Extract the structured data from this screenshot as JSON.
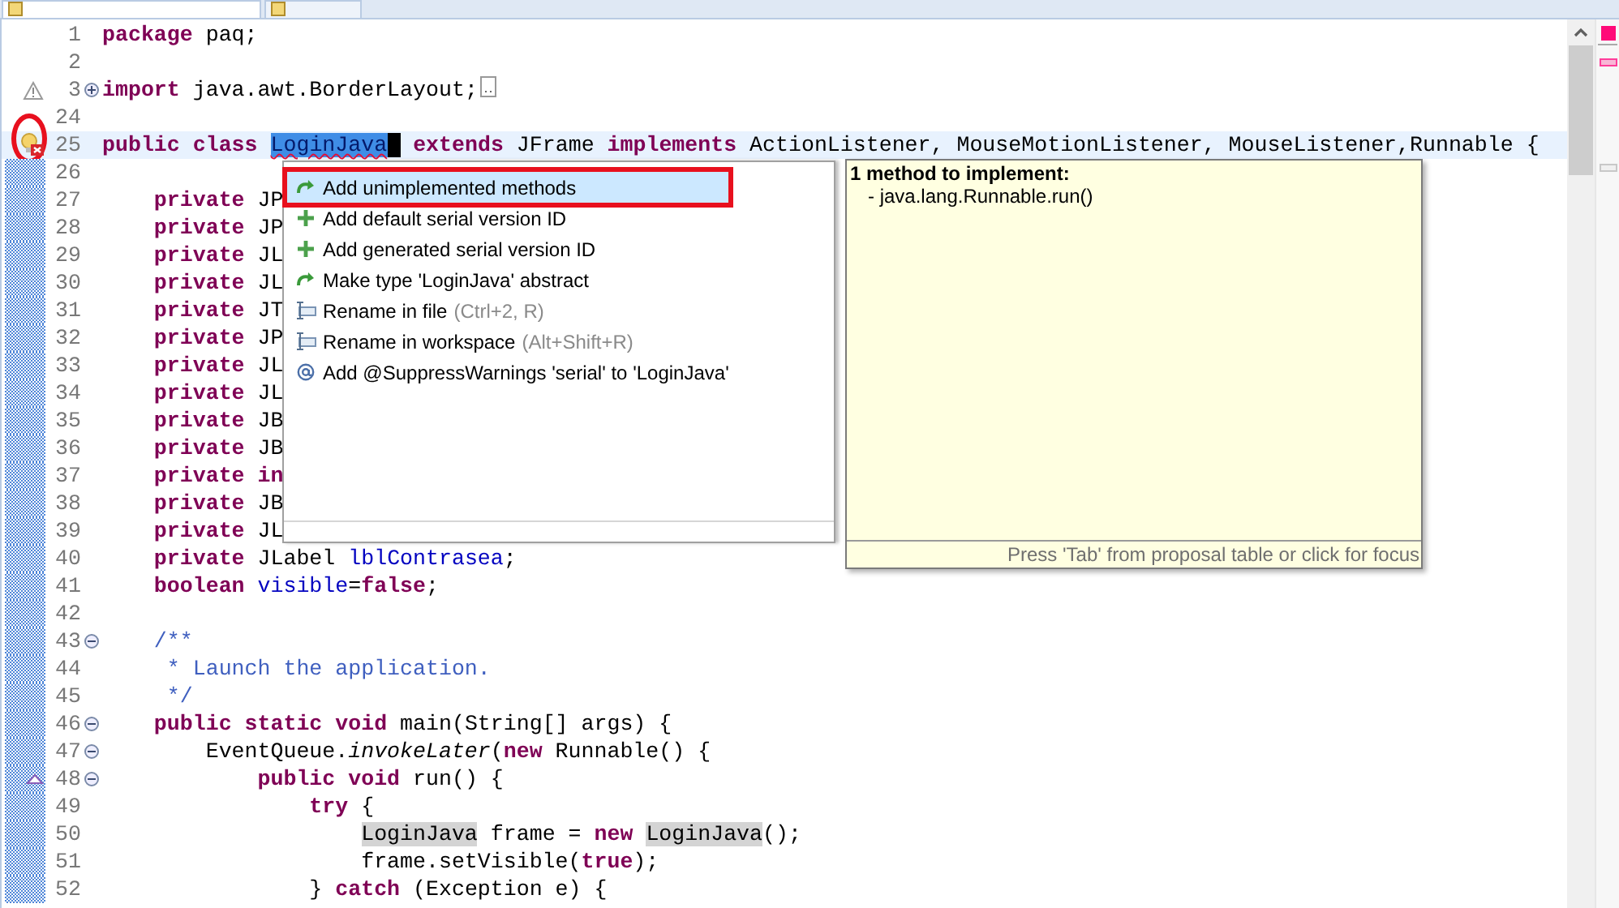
{
  "editor": {
    "lines": [
      {
        "number": "1",
        "changed": false,
        "current": false,
        "circled": false,
        "tokens": [
          {
            "text": "package",
            "kind": "keyword"
          },
          {
            "text": " paq;",
            "kind": "plain"
          }
        ]
      },
      {
        "number": "2",
        "changed": false,
        "current": false,
        "circled": false
      },
      {
        "number": "3",
        "fold": {
          "expanded": false
        },
        "marker": {
          "kind": "warning"
        },
        "changed": false,
        "current": false,
        "circled": false,
        "tokens": [
          {
            "text": "import",
            "kind": "keyword"
          },
          {
            "text": " java.awt.BorderLayout;",
            "kind": "plain"
          }
        ]
      },
      {
        "number": "24",
        "changed": false,
        "current": false,
        "circled": false
      },
      {
        "number": "25",
        "marker": {
          "kind": "quick-fix-error"
        },
        "changed": false,
        "current": true,
        "circled": true,
        "tokens": [
          {
            "text": "public",
            "kind": "keyword"
          },
          {
            "text": " class",
            "kind": "keyword"
          },
          {
            "text": " LoginJava",
            "kind": "selected"
          },
          {
            "text": " extends",
            "kind": "keyword"
          },
          {
            "text": " JFrame",
            "kind": "plain"
          },
          {
            "text": " implements",
            "kind": "keyword"
          },
          {
            "text": " ActionListener, MouseMotionListener, MouseListener,Runnable {",
            "kind": "plain"
          }
        ]
      },
      {
        "number": "26",
        "changed": true,
        "current": false,
        "circled": false
      },
      {
        "number": "27",
        "changed": true,
        "current": false,
        "circled": false,
        "tokens": [
          {
            "text": "    private",
            "kind": "keyword"
          },
          {
            "text": " JP",
            "kind": "plain"
          }
        ]
      },
      {
        "number": "28",
        "changed": true,
        "current": false,
        "circled": false,
        "tokens": [
          {
            "text": "    private",
            "kind": "keyword"
          },
          {
            "text": " JP",
            "kind": "plain"
          }
        ]
      },
      {
        "number": "29",
        "changed": true,
        "current": false,
        "circled": false,
        "tokens": [
          {
            "text": "    private",
            "kind": "keyword"
          },
          {
            "text": " JL",
            "kind": "plain"
          }
        ]
      },
      {
        "number": "30",
        "changed": true,
        "current": false,
        "circled": false,
        "tokens": [
          {
            "text": "    private",
            "kind": "keyword"
          },
          {
            "text": " JL",
            "kind": "plain"
          }
        ]
      },
      {
        "number": "31",
        "changed": true,
        "current": false,
        "circled": false,
        "tokens": [
          {
            "text": "    private",
            "kind": "keyword"
          },
          {
            "text": " JT",
            "kind": "plain"
          }
        ]
      },
      {
        "number": "32",
        "changed": true,
        "current": false,
        "circled": false,
        "tokens": [
          {
            "text": "    private",
            "kind": "keyword"
          },
          {
            "text": " JP",
            "kind": "plain"
          }
        ]
      },
      {
        "number": "33",
        "changed": true,
        "current": false,
        "circled": false,
        "tokens": [
          {
            "text": "    private",
            "kind": "keyword"
          },
          {
            "text": " JL",
            "kind": "plain"
          }
        ]
      },
      {
        "number": "34",
        "changed": true,
        "current": false,
        "circled": false,
        "tokens": [
          {
            "text": "    private",
            "kind": "keyword"
          },
          {
            "text": " JL",
            "kind": "plain"
          }
        ]
      },
      {
        "number": "35",
        "changed": true,
        "current": false,
        "circled": false,
        "tokens": [
          {
            "text": "    private",
            "kind": "keyword"
          },
          {
            "text": " JB",
            "kind": "plain"
          }
        ]
      },
      {
        "number": "36",
        "changed": true,
        "current": false,
        "circled": false,
        "tokens": [
          {
            "text": "    private",
            "kind": "keyword"
          },
          {
            "text": " JB",
            "kind": "plain"
          }
        ]
      },
      {
        "number": "37",
        "changed": true,
        "current": false,
        "circled": false,
        "tokens": [
          {
            "text": "    private",
            "kind": "keyword"
          },
          {
            "text": " in",
            "kind": "keyword"
          }
        ]
      },
      {
        "number": "38",
        "changed": true,
        "current": false,
        "circled": false,
        "tokens": [
          {
            "text": "    private",
            "kind": "keyword"
          },
          {
            "text": " JB",
            "kind": "plain"
          }
        ]
      },
      {
        "number": "39",
        "changed": true,
        "current": false,
        "circled": false,
        "tokens": [
          {
            "text": "    private",
            "kind": "keyword"
          },
          {
            "text": " JL",
            "kind": "plain"
          }
        ]
      },
      {
        "number": "40",
        "changed": true,
        "current": false,
        "circled": false,
        "tokens": [
          {
            "text": "    private",
            "kind": "keyword"
          },
          {
            "text": " JLabel ",
            "kind": "plain"
          },
          {
            "text": "lblContrasea",
            "kind": "field"
          },
          {
            "text": ";",
            "kind": "plain"
          }
        ]
      },
      {
        "number": "41",
        "changed": true,
        "current": false,
        "circled": false,
        "tokens": [
          {
            "text": "    boolean",
            "kind": "keyword"
          },
          {
            "text": " visible",
            "kind": "field"
          },
          {
            "text": "=",
            "kind": "plain"
          },
          {
            "text": "false",
            "kind": "keyword"
          },
          {
            "text": ";",
            "kind": "plain"
          }
        ]
      },
      {
        "number": "42",
        "changed": true,
        "current": false,
        "circled": false
      },
      {
        "number": "43",
        "fold": {
          "expanded": true
        },
        "changed": true,
        "current": false,
        "circled": false,
        "tokens": [
          {
            "text": "    /**",
            "kind": "comment"
          }
        ]
      },
      {
        "number": "44",
        "changed": true,
        "current": false,
        "circled": false,
        "tokens": [
          {
            "text": "     * Launch the application.",
            "kind": "comment"
          }
        ]
      },
      {
        "number": "45",
        "changed": true,
        "current": false,
        "circled": false,
        "tokens": [
          {
            "text": "     */",
            "kind": "comment"
          }
        ]
      },
      {
        "number": "46",
        "fold": {
          "expanded": true
        },
        "changed": true,
        "current": false,
        "circled": false,
        "tokens": [
          {
            "text": "    public",
            "kind": "keyword"
          },
          {
            "text": " static",
            "kind": "keyword"
          },
          {
            "text": " void",
            "kind": "keyword"
          },
          {
            "text": " main(String[] args) {",
            "kind": "plain"
          }
        ]
      },
      {
        "number": "47",
        "fold": {
          "expanded": true
        },
        "changed": true,
        "current": false,
        "circled": false,
        "tokens": [
          {
            "text": "        EventQueue.",
            "kind": "plain"
          },
          {
            "text": "invokeLater",
            "kind": "static-method"
          },
          {
            "text": "(",
            "kind": "plain"
          },
          {
            "text": "new",
            "kind": "keyword"
          },
          {
            "text": " Runnable() {",
            "kind": "plain"
          }
        ]
      },
      {
        "number": "48",
        "fold": {
          "expanded": true
        },
        "marker": {
          "kind": "override"
        },
        "changed": true,
        "current": false,
        "circled": false,
        "tokens": [
          {
            "text": "            public",
            "kind": "keyword"
          },
          {
            "text": " void",
            "kind": "keyword"
          },
          {
            "text": " run() {",
            "kind": "plain"
          }
        ]
      },
      {
        "number": "49",
        "changed": true,
        "current": false,
        "circled": false,
        "tokens": [
          {
            "text": "                try",
            "kind": "keyword"
          },
          {
            "text": " {",
            "kind": "plain"
          }
        ]
      },
      {
        "number": "50",
        "changed": true,
        "current": false,
        "circled": false,
        "tokens": [
          {
            "text": "                    LoginJava",
            "kind": "occurrence"
          },
          {
            "text": " frame = ",
            "kind": "plain"
          },
          {
            "text": "new",
            "kind": "keyword"
          },
          {
            "text": " LoginJava",
            "kind": "occurrence"
          },
          {
            "text": "();",
            "kind": "plain"
          }
        ]
      },
      {
        "number": "51",
        "changed": true,
        "current": false,
        "circled": false,
        "tokens": [
          {
            "text": "                    frame.setVisible(",
            "kind": "plain"
          },
          {
            "text": "true",
            "kind": "keyword"
          },
          {
            "text": ");",
            "kind": "plain"
          }
        ]
      },
      {
        "number": "52",
        "changed": true,
        "current": false,
        "circled": false,
        "tokens": [
          {
            "text": "                } ",
            "kind": "plain"
          },
          {
            "text": "catch",
            "kind": "keyword"
          },
          {
            "text": " (Exception e) {",
            "kind": "plain"
          }
        ]
      }
    ]
  },
  "quick_fix_menu": {
    "items": [
      {
        "kind": "change",
        "label": "Add unimplemented methods",
        "selected": true,
        "annotated": true
      },
      {
        "kind": "add",
        "label": "Add default serial version ID",
        "selected": false,
        "annotated": false
      },
      {
        "kind": "add",
        "label": "Add generated serial version ID",
        "selected": false,
        "annotated": false
      },
      {
        "kind": "change",
        "label": "Make type 'LoginJava' abstract",
        "selected": false,
        "annotated": false
      },
      {
        "kind": "rename",
        "label": "Rename in file",
        "shortcut": "(Ctrl+2, R)",
        "selected": false,
        "annotated": false
      },
      {
        "kind": "rename",
        "label": "Rename in workspace",
        "shortcut": "(Alt+Shift+R)",
        "selected": false,
        "annotated": false
      },
      {
        "kind": "annotation",
        "label": "Add @SuppressWarnings 'serial' to 'LoginJava'",
        "selected": false,
        "annotated": false
      }
    ]
  },
  "info_popup": {
    "title": "1 method to implement:",
    "body": "- java.lang.Runnable.run()",
    "footer": "Press 'Tab' from proposal table or click for focus"
  }
}
